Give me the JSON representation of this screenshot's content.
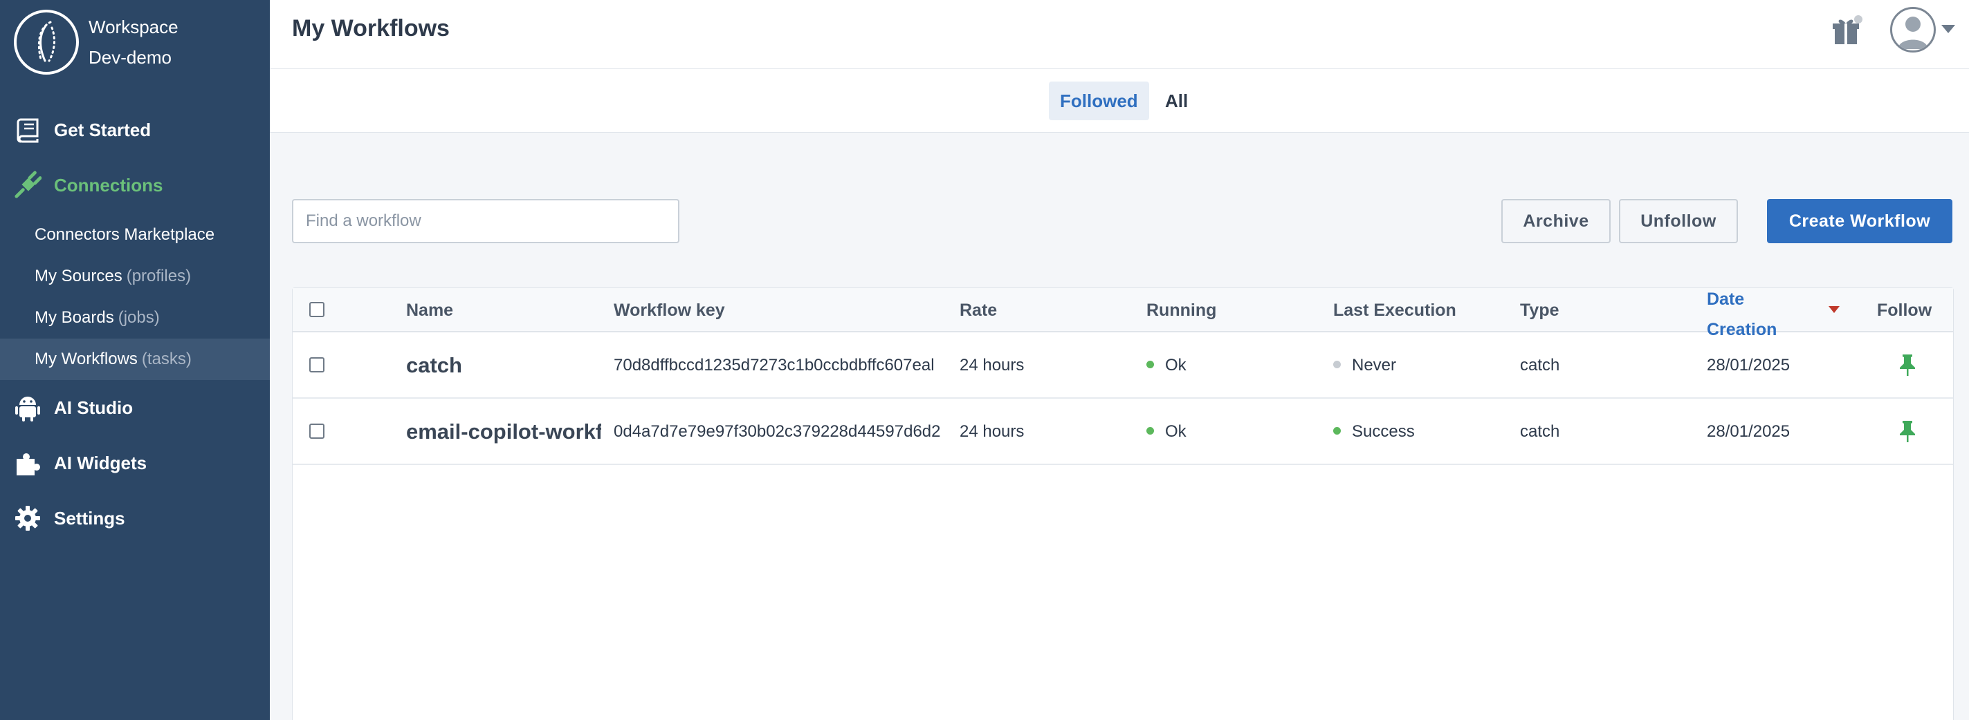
{
  "workspace": {
    "line1": "Workspace",
    "line2": "Dev-demo"
  },
  "sidebar": {
    "items": [
      {
        "label": "Get Started",
        "icon": "book-icon"
      },
      {
        "label": "Connections",
        "icon": "plug-icon",
        "active": true
      },
      {
        "label": "AI Studio",
        "icon": "android-icon"
      },
      {
        "label": "AI Widgets",
        "icon": "puzzle-icon"
      },
      {
        "label": "Settings",
        "icon": "gear-icon"
      }
    ],
    "sub_items": [
      {
        "label": "Connectors Marketplace",
        "muted": ""
      },
      {
        "label": "My Sources",
        "muted": "(profiles)"
      },
      {
        "label": "My Boards",
        "muted": "(jobs)"
      },
      {
        "label": "My Workflows",
        "muted": "(tasks)",
        "selected": true
      }
    ]
  },
  "header": {
    "title": "My Workflows"
  },
  "tabs": [
    {
      "label": "Followed",
      "active": true
    },
    {
      "label": "All",
      "active": false
    }
  ],
  "toolbar": {
    "search_placeholder": "Find a workflow",
    "archive_label": "Archive",
    "unfollow_label": "Unfollow",
    "create_label": "Create Workflow"
  },
  "table": {
    "columns": [
      "Name",
      "Workflow key",
      "Rate",
      "Running",
      "Last Execution",
      "Type",
      "Date",
      "Creation",
      "Follow"
    ],
    "sort_column": "Date Creation",
    "rows": [
      {
        "name": "catch",
        "key": "70d8dffbccd1235d7273c1b0ccbdbffc607eal",
        "rate": "24 hours",
        "running": "Ok",
        "running_color": "#5cb85c",
        "last_execution": "Never",
        "last_color": "#c7ccd2",
        "type": "catch",
        "date": "28/01/2025"
      },
      {
        "name": "email-copilot-workfl",
        "key": "0d4a7d7e79e97f30b02c379228d44597d6d2",
        "rate": "24 hours",
        "running": "Ok",
        "running_color": "#5cb85c",
        "last_execution": "Success",
        "last_color": "#5cb85c",
        "type": "catch",
        "date": "28/01/2025"
      }
    ]
  },
  "colors": {
    "sidebar": "#2c4766",
    "accent": "#2f6fc0",
    "success": "#5cb85c",
    "pin": "#3fa95a"
  }
}
